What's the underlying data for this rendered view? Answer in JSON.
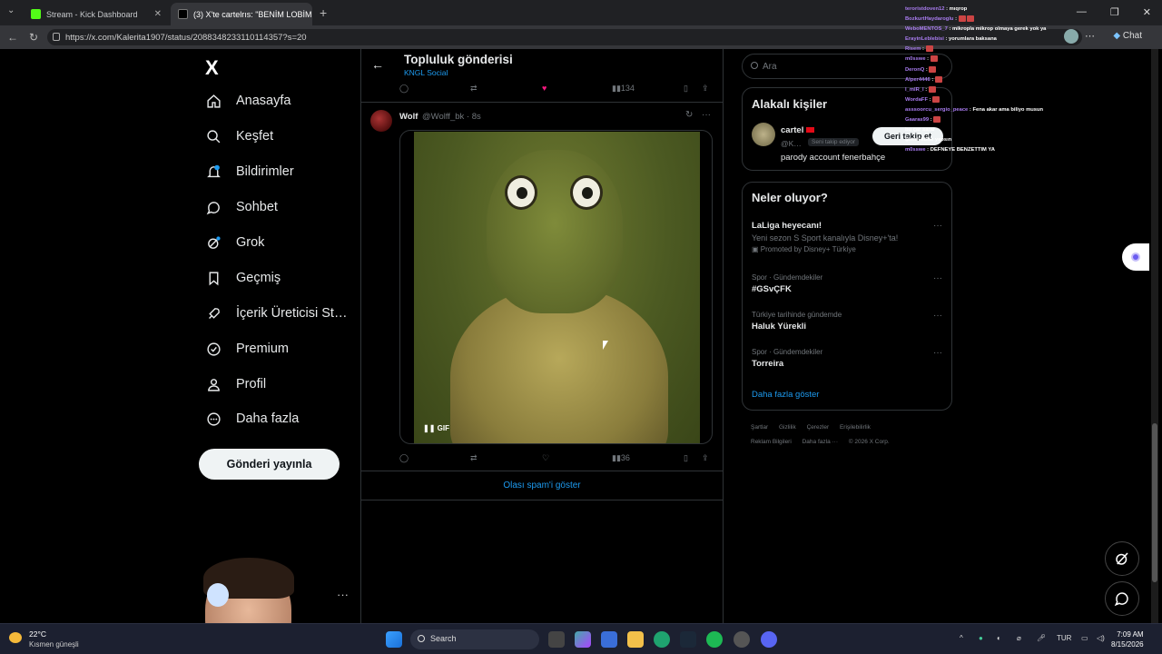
{
  "browser": {
    "tabs": [
      {
        "title": "Stream - Kick Dashboard",
        "icon": "kick-icon",
        "color": "#53fc18"
      },
      {
        "title": "(3) X'te cartelrıs: \"BENİM LOBİM B…",
        "icon": "x-icon",
        "color": "#ffffff"
      }
    ],
    "url": "https://x.com/Kalerita1907/status/2088348233110114357?s=20",
    "chat_label": "Chat"
  },
  "sidebar": {
    "logo": "X",
    "items": [
      {
        "label": "Anasayfa",
        "icon": "home-icon"
      },
      {
        "label": "Keşfet",
        "icon": "search-icon"
      },
      {
        "label": "Bildirimler",
        "icon": "bell-icon"
      },
      {
        "label": "Sohbet",
        "icon": "chat-icon"
      },
      {
        "label": "Grok",
        "icon": "grok-icon"
      },
      {
        "label": "Geçmiş",
        "icon": "bookmark-icon"
      },
      {
        "label": "İçerik Üreticisi St…",
        "icon": "rocket-icon"
      },
      {
        "label": "Premium",
        "icon": "verified-icon"
      },
      {
        "label": "Profil",
        "icon": "person-icon"
      },
      {
        "label": "Daha fazla",
        "icon": "more-circle-icon"
      }
    ],
    "post_button": "Gönderi yayınla"
  },
  "header": {
    "title": "Topluluk gönderisi",
    "subtitle": "KNGL Social"
  },
  "top_actions": {
    "views": "134"
  },
  "tweet": {
    "name": "Wolf",
    "handle": "@Wolff_bk · 8s",
    "gif_badge": "GIF",
    "views": "36"
  },
  "spam_link": "Olası spam'i göster",
  "search": {
    "placeholder": "Ara"
  },
  "related": {
    "title": "Alakalı kişiler",
    "name": "cartel",
    "handle": "@K…",
    "badge": "Seni takip ediyor",
    "bio": "parody account fenerbahçe",
    "button": "Geri takip et"
  },
  "trends": {
    "title": "Neler oluyor?",
    "items": [
      {
        "category": "",
        "name": "LaLiga heyecanı!",
        "sub": "Yeni sezon S Sport kanalıyla Disney+'ta!",
        "promo": "Promoted by Disney+ Türkiye"
      },
      {
        "category": "Spor · Gündemdekiler",
        "name": "#GSvÇFK",
        "sub": "",
        "promo": ""
      },
      {
        "category": "Türkiye tarihinde gündemde",
        "name": "Haluk Yürekli",
        "sub": "",
        "promo": ""
      },
      {
        "category": "Spor · Gündemdekiler",
        "name": "Torreira",
        "sub": "",
        "promo": ""
      }
    ],
    "show_more": "Daha fazla göster"
  },
  "footer": {
    "line1": [
      "Şartlar",
      "Gizlilik",
      "Çerezler",
      "Erişilebilirlik"
    ],
    "line2": [
      "Reklam Bilgileri",
      "Daha fazla ···",
      "© 2026 X Corp."
    ]
  },
  "stream_chat": [
    {
      "user": "teroristdoven12",
      "msg": "mıqrop"
    },
    {
      "user": "BozkurtHaydaroglu",
      "msg": ""
    },
    {
      "user": "WeboMENTOS_7",
      "msg": "mikropla mikrop olmaya gerek yok ya"
    },
    {
      "user": "ErayinLeblebisi",
      "msg": "yorumlara baksana"
    },
    {
      "user": "Risem",
      "msg": ""
    },
    {
      "user": "m0sswe",
      "msg": ""
    },
    {
      "user": "DeronQ",
      "msg": ""
    },
    {
      "user": "Alper4446",
      "msg": ""
    },
    {
      "user": "l_mlR_l",
      "msg": ""
    },
    {
      "user": "WordaFF",
      "msg": ""
    },
    {
      "user": "asssoorcu_sergio_peace",
      "msg": "Fena akar ama biliyo musun"
    },
    {
      "user": "Gaaras99",
      "msg": ""
    },
    {
      "user": "",
      "msg": "bu çar sarar"
    },
    {
      "user": "",
      "msg": "Şimdi köfte yapsın"
    },
    {
      "user": "m0sswe",
      "msg": "DEFNEYE BENZETTIM YA"
    }
  ],
  "taskbar": {
    "weather_temp": "22°C",
    "weather_desc": "Kısmen güneşli",
    "search": "Search",
    "lang": "TUR",
    "time": "7:09 AM",
    "date": "8/15/2026"
  }
}
